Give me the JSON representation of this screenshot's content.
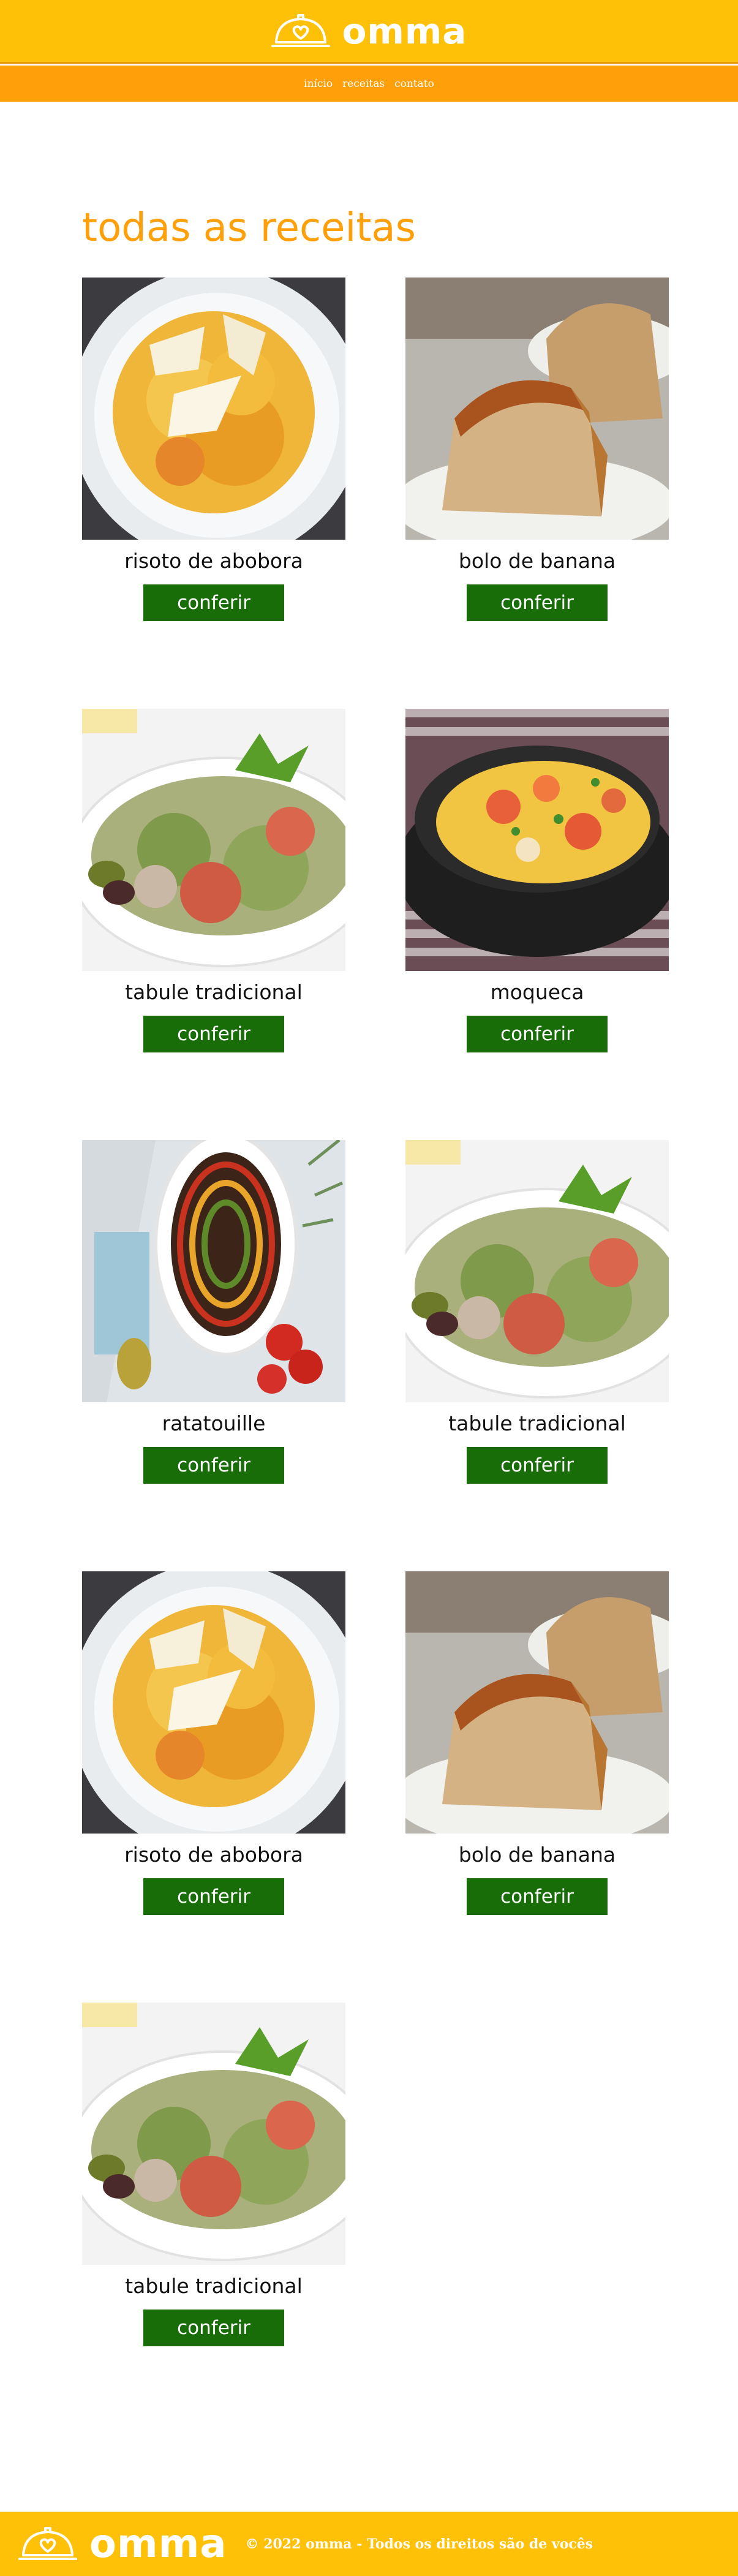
{
  "brand": {
    "name": "omma",
    "logo_icon": "heart-cloche-icon"
  },
  "nav": {
    "items": [
      {
        "label": "início"
      },
      {
        "label": "receitas"
      },
      {
        "label": "contato"
      }
    ]
  },
  "main": {
    "title": "todas as receitas",
    "button_label": "conferir",
    "recipes": [
      {
        "name": "risoto de abobora",
        "image": "risotto"
      },
      {
        "name": "bolo de banana",
        "image": "banana-cake"
      },
      {
        "name": "tabule tradicional",
        "image": "tabbouleh"
      },
      {
        "name": "moqueca",
        "image": "moqueca"
      },
      {
        "name": "ratatouille",
        "image": "ratatouille"
      },
      {
        "name": "tabule tradicional",
        "image": "tabbouleh"
      },
      {
        "name": "risoto de abobora",
        "image": "risotto"
      },
      {
        "name": "bolo de banana",
        "image": "banana-cake"
      },
      {
        "name": "tabule tradicional",
        "image": "tabbouleh"
      }
    ]
  },
  "footer": {
    "text": "© 2022 omma - Todos os direitos são de vocês"
  },
  "colors": {
    "header": "#ffc107",
    "nav": "#ff9f0a",
    "title": "#ff9f0a",
    "button": "#196d08"
  }
}
